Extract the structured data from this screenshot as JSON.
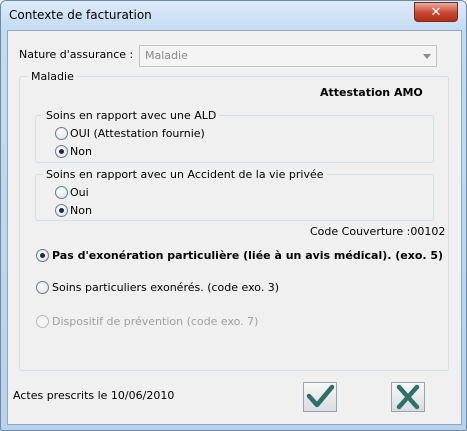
{
  "window": {
    "title": "Contexte de facturation",
    "close_symbol": "✕"
  },
  "insurance": {
    "label": "Nature d'assurance :",
    "value": "Maladie"
  },
  "maladie_group": {
    "caption": "Maladie",
    "attestation": "Attestation AMO"
  },
  "ald_group": {
    "caption": "Soins en rapport avec une  ALD",
    "options": [
      {
        "label": "OUI (Attestation fournie)",
        "checked": false
      },
      {
        "label": "Non",
        "checked": true
      }
    ]
  },
  "accident_group": {
    "caption": "Soins en rapport avec un  Accident de la vie privée",
    "options": [
      {
        "label": "Oui",
        "checked": false
      },
      {
        "label": "Non",
        "checked": true
      }
    ]
  },
  "code_couverture": "Code Couverture :00102",
  "exo_options": [
    {
      "label": "Pas d'exonération particulière (liée à un avis médical).  (exo. 5)",
      "checked": true,
      "enabled": true
    },
    {
      "label": "Soins particuliers exonérés.  (code exo. 3)",
      "checked": false,
      "enabled": true
    },
    {
      "label": "Dispositif de prévention  (code exo. 7)",
      "checked": false,
      "enabled": false
    }
  ],
  "footer": {
    "actes": "Actes prescrits le 10/06/2010"
  },
  "colors": {
    "ok_check": "#2f6f68",
    "cancel_x": "#2f6f68"
  }
}
